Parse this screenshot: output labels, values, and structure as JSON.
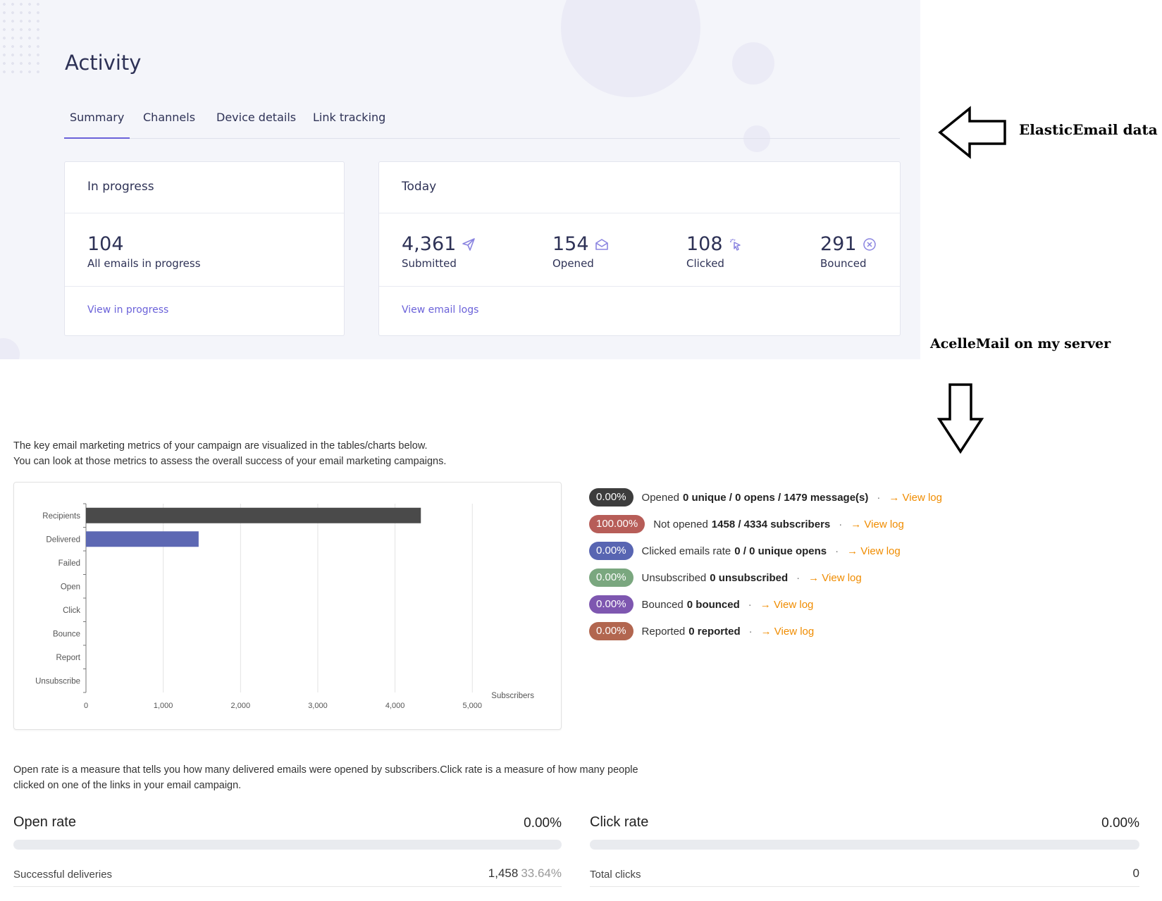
{
  "elastic": {
    "title": "Activity",
    "tabs": [
      {
        "label": "Summary",
        "active": true
      },
      {
        "label": "Channels",
        "active": false
      },
      {
        "label": "Device details",
        "active": false
      },
      {
        "label": "Link tracking",
        "active": false
      }
    ],
    "in_progress": {
      "title": "In progress",
      "count": "104",
      "label": "All emails in progress",
      "link": "View in progress"
    },
    "today": {
      "title": "Today",
      "metrics": [
        {
          "value": "4,361",
          "label": "Submitted",
          "icon": "paper-plane-icon"
        },
        {
          "value": "154",
          "label": "Opened",
          "icon": "open-envelope-icon"
        },
        {
          "value": "108",
          "label": "Clicked",
          "icon": "cursor-click-icon"
        },
        {
          "value": "291",
          "label": "Bounced",
          "icon": "circle-x-icon"
        }
      ],
      "link": "View email logs"
    }
  },
  "annotations": {
    "elastic": "ElasticEmail data",
    "acelle": "AcelleMail on my server"
  },
  "acelle": {
    "intro_line1": "The key email marketing metrics of your campaign are visualized in the tables/charts below.",
    "intro_line2": "You can look at those metrics to assess the overall success of your email marketing campaigns.",
    "stats": [
      {
        "pct": "0.00%",
        "color": "#3d3d3d",
        "label": "Opened",
        "detail": "0 unique / 0 opens / 1479 message(s)",
        "link": "View log"
      },
      {
        "pct": "100.00%",
        "color": "#b75d58",
        "label": "Not opened",
        "detail": "1458 / 4334 subscribers",
        "link": "View log"
      },
      {
        "pct": "0.00%",
        "color": "#5865b2",
        "label": "Clicked emails rate",
        "detail": "0 / 0 unique opens",
        "link": "View log"
      },
      {
        "pct": "0.00%",
        "color": "#7aa77f",
        "label": "Unsubscribed",
        "detail": "0 unsubscribed",
        "link": "View log"
      },
      {
        "pct": "0.00%",
        "color": "#7e57b0",
        "label": "Bounced",
        "detail": "0 bounced",
        "link": "View log"
      },
      {
        "pct": "0.00%",
        "color": "#b2664f",
        "label": "Reported",
        "detail": "0 reported",
        "link": "View log"
      }
    ],
    "rate_para_line1": "Open rate is a measure that tells you how many delivered emails were opened by subscribers.Click rate is a measure of how many people",
    "rate_para_line2": "clicked on one of the links in your email campaign.",
    "open_rate": {
      "title": "Open rate",
      "value": "0.00%",
      "fill": 0,
      "row_label": "Successful deliveries",
      "row_value": "1,458",
      "row_pct": "33.64%"
    },
    "click_rate": {
      "title": "Click rate",
      "value": "0.00%",
      "fill": 0,
      "row_label": "Total clicks",
      "row_value": "0"
    }
  },
  "chart_data": {
    "type": "bar",
    "orientation": "horizontal",
    "categories": [
      "Recipients",
      "Delivered",
      "Failed",
      "Open",
      "Click",
      "Bounce",
      "Report",
      "Unsubscribe"
    ],
    "values": [
      4334,
      1458,
      0,
      0,
      0,
      0,
      0,
      0
    ],
    "colors": [
      "#4a4a4a",
      "#5d68b3",
      "#4a4a4a",
      "#4a4a4a",
      "#4a4a4a",
      "#4a4a4a",
      "#4a4a4a",
      "#4a4a4a"
    ],
    "x_ticks": [
      "0",
      "1,000",
      "2,000",
      "3,000",
      "4,000",
      "5,000"
    ],
    "xlim": [
      0,
      5800
    ],
    "xlabel": "Subscribers",
    "ylabel": "",
    "grid": true
  }
}
